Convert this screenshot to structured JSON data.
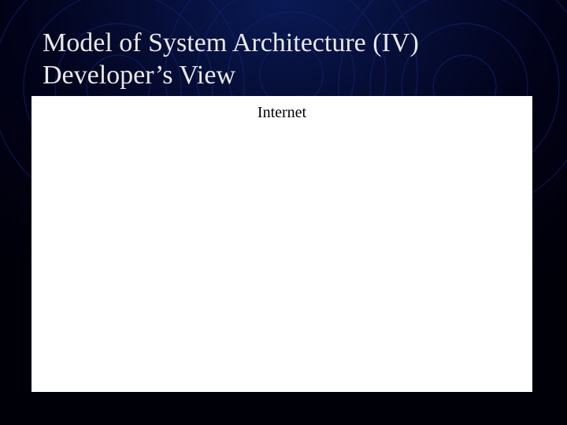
{
  "title": {
    "line1": "Model of System Architecture (IV)",
    "line2": "Developer’s View"
  },
  "panel": {
    "label": "Internet"
  },
  "colors": {
    "background": "#000011",
    "ring_stroke": "#0b1a66",
    "title_text": "#e8e8e8",
    "panel_bg": "#ffffff",
    "panel_text": "#000000"
  }
}
